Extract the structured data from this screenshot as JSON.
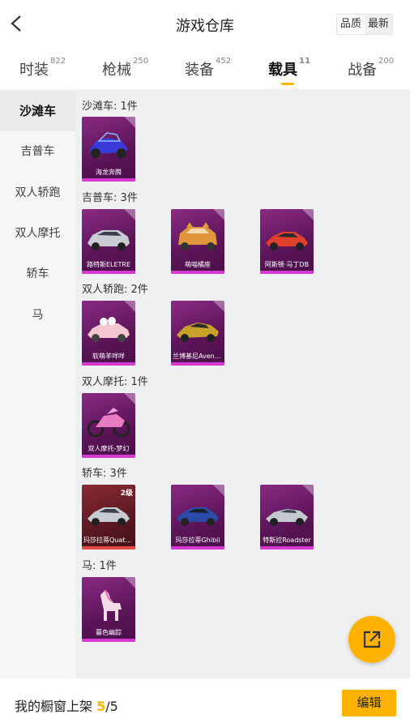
{
  "header": {
    "title": "游戏仓库",
    "sort_quality": "品质",
    "sort_newest": "最新"
  },
  "tabs": [
    {
      "label": "时装",
      "count": "822"
    },
    {
      "label": "枪械",
      "count": "250"
    },
    {
      "label": "装备",
      "count": "452"
    },
    {
      "label": "载具",
      "count": "11"
    },
    {
      "label": "战备",
      "count": "200"
    }
  ],
  "active_tab": "载具",
  "sidebar": {
    "items": [
      "沙滩车",
      "吉普车",
      "双人轿跑",
      "双人摩托",
      "轿车",
      "马"
    ],
    "active": "沙滩车"
  },
  "groups": [
    {
      "title": "沙滩车: 1件",
      "items": [
        {
          "name": "海龙奔腾",
          "icon": "dune-buggy-icon"
        }
      ]
    },
    {
      "title": "吉普车: 3件",
      "items": [
        {
          "name": "路特斯ELETRE",
          "icon": "silver-suv-icon"
        },
        {
          "name": "萌喵橘座",
          "icon": "orange-cat-jeep-icon"
        },
        {
          "name": "阿斯顿·马丁DB",
          "icon": "red-coupe-icon"
        }
      ]
    },
    {
      "title": "双人轿跑: 2件",
      "items": [
        {
          "name": "软萌羊咩咩",
          "icon": "pink-sheep-car-icon"
        },
        {
          "name": "兰博基尼Aventador",
          "icon": "gold-supercar-icon"
        }
      ]
    },
    {
      "title": "双人摩托: 1件",
      "items": [
        {
          "name": "双人摩托-梦幻",
          "icon": "pink-motorcycle-icon"
        }
      ]
    },
    {
      "title": "轿车: 3件",
      "items": [
        {
          "name": "玛莎拉蒂Quattroporte",
          "icon": "silver-sedan-icon",
          "level": "2级",
          "rarity": "red"
        },
        {
          "name": "玛莎拉蒂Ghibli",
          "icon": "blue-sedan-icon"
        },
        {
          "name": "特斯拉Roadster",
          "icon": "silver-roadster-icon"
        }
      ]
    },
    {
      "title": "马: 1件",
      "items": [
        {
          "name": "暮色幽踪",
          "icon": "pink-horse-icon"
        }
      ]
    }
  ],
  "footer": {
    "label": "我的橱窗上架",
    "current": "5",
    "sep": "/",
    "total": "5",
    "edit_label": "编辑"
  },
  "colors": {
    "accent": "#ffb300",
    "card_purple": "#7a2374",
    "card_red": "#7a2430",
    "card_bar": "#d43ad0"
  }
}
